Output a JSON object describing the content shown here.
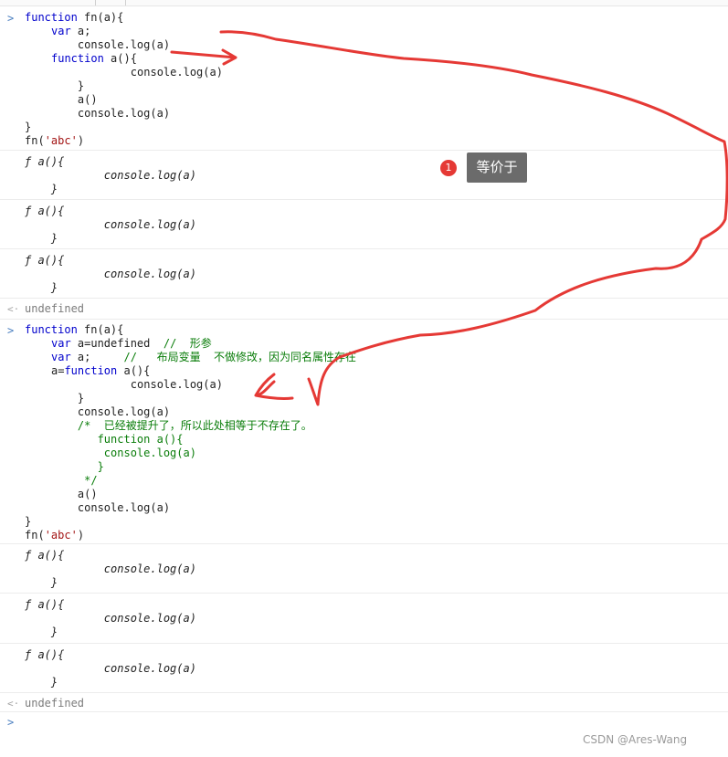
{
  "console": {
    "prompt_symbol": ">",
    "result_symbol": "<·",
    "block1": {
      "lines": [
        "function fn(a){",
        "    var a;",
        "    console.log(a)",
        "    function a(){",
        "        console.log(a)",
        "    }",
        "    a()",
        "    console.log(a)",
        "}",
        "fn('abc')"
      ]
    },
    "block2": {
      "lines": [
        "function fn(a){",
        "    var a=undefined  //  形参",
        "    var a;     //   布局变量  不做修改，因为同名属性存在",
        "    a=function a(){",
        "        console.log(a)",
        "    }",
        "    console.log(a)",
        "    /*  已经被提升了，所以此处相等于不存在了。",
        "       function a(){",
        "        console.log(a)",
        "       }",
        "     */",
        "    a()",
        "    console.log(a)",
        "}",
        "fn('abc')"
      ]
    },
    "output_func": {
      "line1": "ƒ a(){",
      "line2": "        console.log(a)",
      "line3": "    }"
    },
    "undefined_text": "undefined"
  },
  "annotation": {
    "badge_number": "1",
    "tooltip": "等价于",
    "ink_color": "#e53935"
  },
  "watermark": "CSDN @Ares-Wang"
}
